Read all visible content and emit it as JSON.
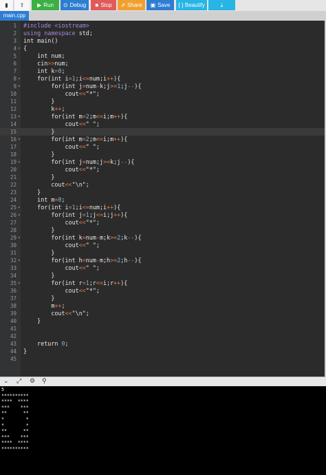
{
  "toolbar": {
    "file_icon": "file-icon",
    "share_icon": "share-icon",
    "run_label": "Run",
    "debug_label": "Debug",
    "stop_label": "Stop",
    "share_label": "Share",
    "save_label": "Save",
    "beautify_label": "{ } Beautify",
    "download_icon": "download-icon"
  },
  "tab": {
    "label": "main.cpp"
  },
  "editor": {
    "active_line": 15,
    "lines": [
      [
        [
          "pp",
          "#include <iostream>"
        ]
      ],
      [
        [
          "pp",
          "using namespace "
        ],
        [
          "kw",
          "std;"
        ]
      ],
      [
        [
          "kw",
          "int main()"
        ]
      ],
      [
        [
          "kw",
          "{"
        ]
      ],
      [
        [
          "kw",
          "    int num;"
        ]
      ],
      [
        [
          "kw",
          "    cin"
        ],
        [
          "op",
          ">>"
        ],
        [
          "kw",
          "num;"
        ]
      ],
      [
        [
          "kw",
          "    int k"
        ],
        [
          "op",
          "="
        ],
        [
          "num",
          "0"
        ],
        [
          "kw",
          ";"
        ]
      ],
      [
        [
          "kw",
          "    for(int i"
        ],
        [
          "op",
          "="
        ],
        [
          "num",
          "1"
        ],
        [
          "kw",
          ";i"
        ],
        [
          "op",
          "<="
        ],
        [
          "kw",
          "num;i"
        ],
        [
          "op",
          "++"
        ],
        [
          "kw",
          "){"
        ]
      ],
      [
        [
          "kw",
          "        for(int j"
        ],
        [
          "op",
          "="
        ],
        [
          "kw",
          "num"
        ],
        [
          "op",
          "-"
        ],
        [
          "kw",
          "k;j"
        ],
        [
          "op",
          ">="
        ],
        [
          "num",
          "1"
        ],
        [
          "kw",
          ";j"
        ],
        [
          "op",
          "--"
        ],
        [
          "kw",
          "){"
        ]
      ],
      [
        [
          "kw",
          "            cout"
        ],
        [
          "op",
          "<<"
        ],
        [
          "str",
          "\"*\";"
        ]
      ],
      [
        [
          "kw",
          "        }"
        ]
      ],
      [
        [
          "kw",
          "        k"
        ],
        [
          "op",
          "++"
        ],
        [
          "kw",
          ";"
        ]
      ],
      [
        [
          "kw",
          "        for(int m"
        ],
        [
          "op",
          "="
        ],
        [
          "num",
          "2"
        ],
        [
          "kw",
          ";m"
        ],
        [
          "op",
          "<="
        ],
        [
          "kw",
          "i;m"
        ],
        [
          "op",
          "++"
        ],
        [
          "kw",
          "){"
        ]
      ],
      [
        [
          "kw",
          "            cout"
        ],
        [
          "op",
          "<<"
        ],
        [
          "str",
          "\" \";"
        ]
      ],
      [
        [
          "kw",
          "        }"
        ]
      ],
      [
        [
          "kw",
          "        for(int m"
        ],
        [
          "op",
          "="
        ],
        [
          "num",
          "2"
        ],
        [
          "kw",
          ";m"
        ],
        [
          "op",
          "<="
        ],
        [
          "kw",
          "i;m"
        ],
        [
          "op",
          "++"
        ],
        [
          "kw",
          "){"
        ]
      ],
      [
        [
          "kw",
          "            cout"
        ],
        [
          "op",
          "<<"
        ],
        [
          "str",
          "\" \";"
        ]
      ],
      [
        [
          "kw",
          "        }"
        ]
      ],
      [
        [
          "kw",
          "        for(int j"
        ],
        [
          "op",
          "="
        ],
        [
          "kw",
          "num;j"
        ],
        [
          "op",
          ">="
        ],
        [
          "kw",
          "k;j"
        ],
        [
          "op",
          "--"
        ],
        [
          "kw",
          "){"
        ]
      ],
      [
        [
          "kw",
          "            cout"
        ],
        [
          "op",
          "<<"
        ],
        [
          "str",
          "\"*\";"
        ]
      ],
      [
        [
          "kw",
          "        }"
        ]
      ],
      [
        [
          "kw",
          "        cout"
        ],
        [
          "op",
          "<<"
        ],
        [
          "str",
          "\"\\n\";"
        ]
      ],
      [
        [
          "kw",
          "    }"
        ]
      ],
      [
        [
          "kw",
          "    int m"
        ],
        [
          "op",
          "="
        ],
        [
          "num",
          "0"
        ],
        [
          "kw",
          ";"
        ]
      ],
      [
        [
          "kw",
          "    for(int i"
        ],
        [
          "op",
          "="
        ],
        [
          "num",
          "1"
        ],
        [
          "kw",
          ";i"
        ],
        [
          "op",
          "<="
        ],
        [
          "kw",
          "num;i"
        ],
        [
          "op",
          "++"
        ],
        [
          "kw",
          "){"
        ]
      ],
      [
        [
          "kw",
          "        for(int j"
        ],
        [
          "op",
          "="
        ],
        [
          "num",
          "1"
        ],
        [
          "kw",
          ";j"
        ],
        [
          "op",
          "<="
        ],
        [
          "kw",
          "i;j"
        ],
        [
          "op",
          "++"
        ],
        [
          "kw",
          "){"
        ]
      ],
      [
        [
          "kw",
          "            cout"
        ],
        [
          "op",
          "<<"
        ],
        [
          "str",
          "\"*\";"
        ]
      ],
      [
        [
          "kw",
          "        }"
        ]
      ],
      [
        [
          "kw",
          "        for(int k"
        ],
        [
          "op",
          "="
        ],
        [
          "kw",
          "num"
        ],
        [
          "op",
          "-"
        ],
        [
          "kw",
          "m;k"
        ],
        [
          "op",
          ">="
        ],
        [
          "num",
          "2"
        ],
        [
          "kw",
          ";k"
        ],
        [
          "op",
          "--"
        ],
        [
          "kw",
          "){"
        ]
      ],
      [
        [
          "kw",
          "            cout"
        ],
        [
          "op",
          "<<"
        ],
        [
          "str",
          "\" \";"
        ]
      ],
      [
        [
          "kw",
          "        }"
        ]
      ],
      [
        [
          "kw",
          "        for(int h"
        ],
        [
          "op",
          "="
        ],
        [
          "kw",
          "num"
        ],
        [
          "op",
          "-"
        ],
        [
          "kw",
          "m;h"
        ],
        [
          "op",
          ">="
        ],
        [
          "num",
          "2"
        ],
        [
          "kw",
          ";h"
        ],
        [
          "op",
          "--"
        ],
        [
          "kw",
          "){"
        ]
      ],
      [
        [
          "kw",
          "            cout"
        ],
        [
          "op",
          "<<"
        ],
        [
          "str",
          "\" \";"
        ]
      ],
      [
        [
          "kw",
          "        }"
        ]
      ],
      [
        [
          "kw",
          "        for(int r"
        ],
        [
          "op",
          "="
        ],
        [
          "num",
          "1"
        ],
        [
          "kw",
          ";r"
        ],
        [
          "op",
          "<="
        ],
        [
          "kw",
          "i;r"
        ],
        [
          "op",
          "++"
        ],
        [
          "kw",
          "){"
        ]
      ],
      [
        [
          "kw",
          "            cout"
        ],
        [
          "op",
          "<<"
        ],
        [
          "str",
          "\"*\";"
        ]
      ],
      [
        [
          "kw",
          "        }"
        ]
      ],
      [
        [
          "kw",
          "        m"
        ],
        [
          "op",
          "++"
        ],
        [
          "kw",
          ";"
        ]
      ],
      [
        [
          "kw",
          "        cout"
        ],
        [
          "op",
          "<<"
        ],
        [
          "str",
          "\"\\n\";"
        ]
      ],
      [
        [
          "kw",
          "    }"
        ]
      ],
      [
        [
          "kw",
          ""
        ]
      ],
      [
        [
          "kw",
          ""
        ]
      ],
      [
        [
          "kw",
          "    return "
        ],
        [
          "num",
          "0"
        ],
        [
          "kw",
          ";"
        ]
      ],
      [
        [
          "kw",
          "}"
        ]
      ],
      [
        [
          "kw",
          ""
        ]
      ]
    ],
    "fold_lines": [
      4,
      8,
      9,
      13,
      16,
      19,
      25,
      26,
      29,
      32,
      35
    ]
  },
  "console_bar": {
    "icons": [
      "chevron-down-icon",
      "expand-icon",
      "settings-icon",
      "pin-icon"
    ]
  },
  "console": {
    "lines": [
      "5",
      "**********",
      "****  ****",
      "***    ***",
      "**      **",
      "*        *",
      "*        *",
      "**      **",
      "***    ***",
      "****  ****",
      "**********"
    ]
  }
}
